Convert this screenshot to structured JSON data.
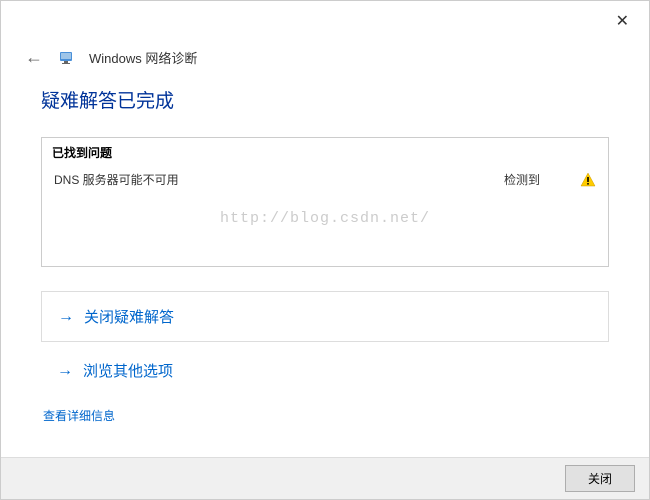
{
  "window": {
    "title": "Windows 网络诊断"
  },
  "heading": "疑难解答已完成",
  "problems": {
    "header": "已找到问题",
    "items": [
      {
        "description": "DNS 服务器可能不可用",
        "status": "检测到"
      }
    ]
  },
  "watermark": "http://blog.csdn.net/",
  "actions": {
    "close_troubleshooter": "关闭疑难解答",
    "browse_other": "浏览其他选项"
  },
  "detail_link": "查看详细信息",
  "footer": {
    "close_button": "关闭"
  }
}
